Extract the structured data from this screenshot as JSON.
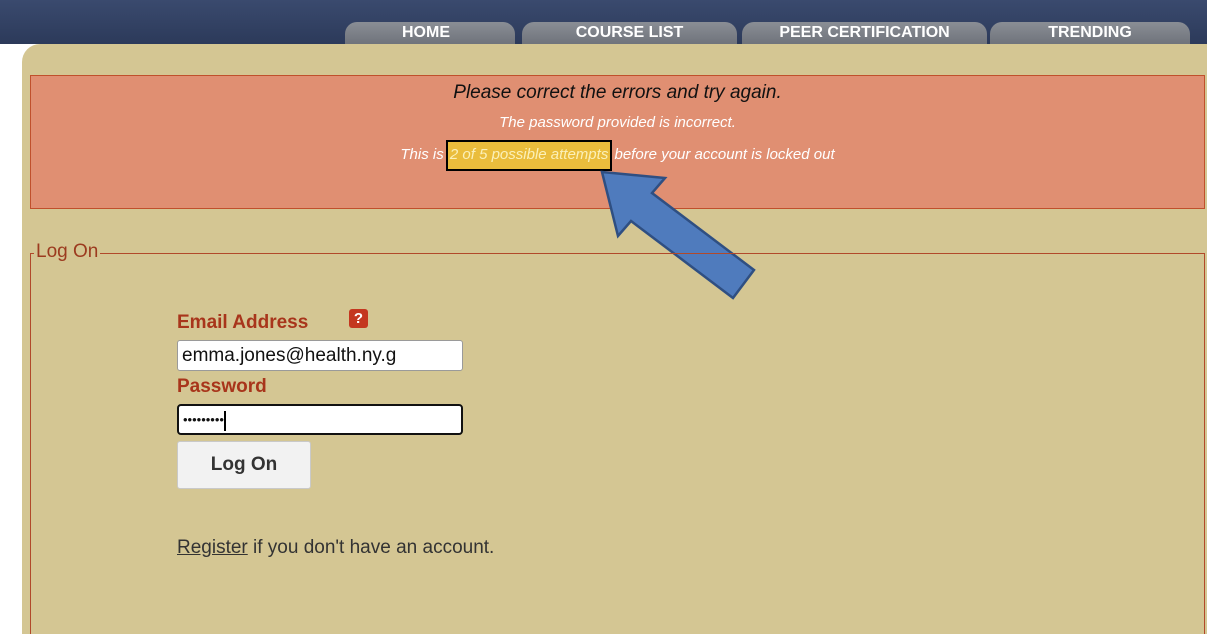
{
  "nav": {
    "tabs": [
      {
        "label": "HOME"
      },
      {
        "label": "COURSE LIST"
      },
      {
        "label": "PEER CERTIFICATION"
      },
      {
        "label": "TRENDING"
      }
    ]
  },
  "error": {
    "title": "Please correct the errors and try again.",
    "line1": "The password provided is incorrect.",
    "line2_prefix": "This is ",
    "line2_highlight": "2 of 5 possible attempts",
    "line2_suffix": " before your account is locked out"
  },
  "logon": {
    "legend": "Log On",
    "email_label": "Email Address",
    "email_value": "emma.jones@health.ny.g",
    "help_icon": "question-mark-icon",
    "password_label": "Password",
    "password_masked": "•••••••••",
    "button_label": "Log On",
    "register_link": "Register",
    "register_suffix": " if you don't have an account."
  },
  "colors": {
    "error_bg": "#e08f72",
    "highlight_bg": "#eabd3c",
    "panel_bg": "#d4c693",
    "label_color": "#a8351b",
    "arrow_fill": "#4f7bbd",
    "arrow_stroke": "#2f4f82"
  }
}
